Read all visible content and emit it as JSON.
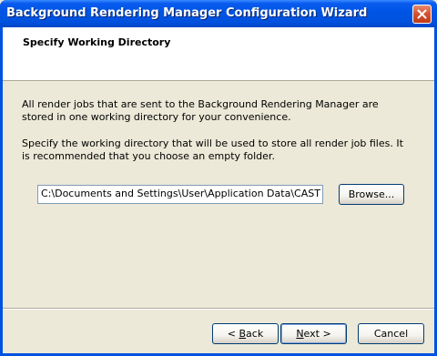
{
  "window": {
    "title": "Background Rendering Manager Configuration Wizard"
  },
  "header": {
    "title": "Specify Working Directory"
  },
  "body": {
    "paragraph1": "All render jobs that are sent to the Background Rendering Manager are stored in one working directory for your convenience.",
    "paragraph2": "Specify the working directory that will be used to store all render job files. It is recommended that you choose an empty folder."
  },
  "directory": {
    "value": "C:\\Documents and Settings\\User\\Application Data\\CAST Softwa",
    "browse_label": "Browse..."
  },
  "footer": {
    "back_prefix": "< ",
    "back_mnemonic": "B",
    "back_rest": "ack",
    "next_mnemonic": "N",
    "next_rest": "ext >",
    "cancel_label": "Cancel"
  },
  "icons": {
    "close": "close-icon"
  }
}
